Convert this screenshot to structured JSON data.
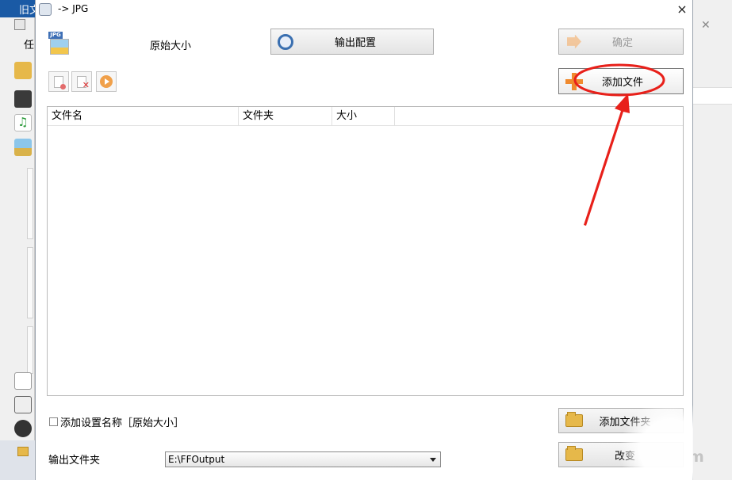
{
  "background_app": {
    "title_fragment": "旧文",
    "sidebar_label": "任",
    "watermark": "m"
  },
  "dialog": {
    "title": "-> JPG",
    "close_glyph": "×",
    "preset_label": "原始大小",
    "output_config_label": "输出配置",
    "ok_label": "确定",
    "add_file_label": "添加文件",
    "table": {
      "columns": [
        "文件名",
        "文件夹",
        "大小"
      ],
      "rows": []
    },
    "add_setting_name_label": "添加设置名称［原始大小］",
    "add_setting_name_checked": false,
    "output_folder_label": "输出文件夹",
    "output_folder_value": "E:\\FFOutput",
    "add_folder_label": "添加文件夹",
    "change_label": "改变"
  },
  "colors": {
    "annotation_red": "#e8201a",
    "titlebar_blue": "#1a5aa5",
    "add_icon_orange": "#f08a2e"
  },
  "icons": [
    "jpg-file-icon",
    "settings-gear-icon",
    "arrow-right-icon",
    "plus-icon",
    "clear-list-icon",
    "remove-file-icon",
    "play-icon",
    "folder-icon"
  ]
}
